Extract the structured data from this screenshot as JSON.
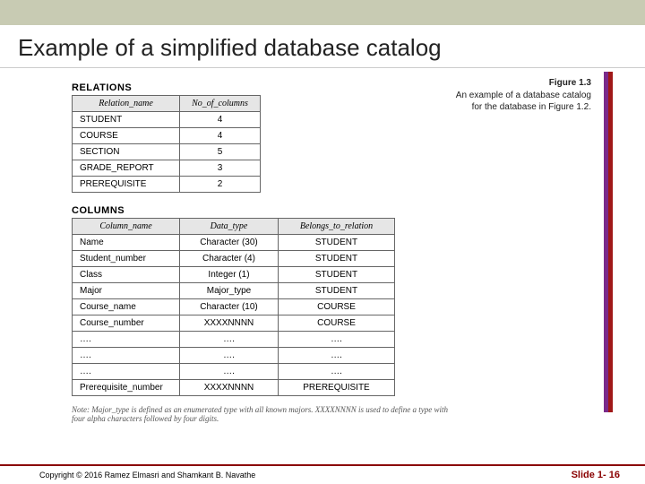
{
  "title": "Example of a simplified database catalog",
  "figure": {
    "number": "Figure 1.3",
    "text": "An example of a database catalog for the database in Figure 1.2."
  },
  "relations": {
    "label": "RELATIONS",
    "headers": [
      "Relation_name",
      "No_of_columns"
    ],
    "rows": [
      [
        "STUDENT",
        "4"
      ],
      [
        "COURSE",
        "4"
      ],
      [
        "SECTION",
        "5"
      ],
      [
        "GRADE_REPORT",
        "3"
      ],
      [
        "PREREQUISITE",
        "2"
      ]
    ]
  },
  "columns": {
    "label": "COLUMNS",
    "headers": [
      "Column_name",
      "Data_type",
      "Belongs_to_relation"
    ],
    "rows": [
      [
        "Name",
        "Character (30)",
        "STUDENT"
      ],
      [
        "Student_number",
        "Character (4)",
        "STUDENT"
      ],
      [
        "Class",
        "Integer (1)",
        "STUDENT"
      ],
      [
        "Major",
        "Major_type",
        "STUDENT"
      ],
      [
        "Course_name",
        "Character (10)",
        "COURSE"
      ],
      [
        "Course_number",
        "XXXXNNNN",
        "COURSE"
      ],
      [
        "….",
        "….",
        "…."
      ],
      [
        "….",
        "….",
        "…."
      ],
      [
        "….",
        "….",
        "…."
      ],
      [
        "Prerequisite_number",
        "XXXXNNNN",
        "PREREQUISITE"
      ]
    ]
  },
  "note": "Note: Major_type is defined as an enumerated type with all known majors. XXXXNNNN is used to define a type with four alpha characters followed by four digits.",
  "footer": {
    "copyright": "Copyright © 2016 Ramez Elmasri and Shamkant B. Navathe",
    "slide": "Slide 1- 16"
  }
}
